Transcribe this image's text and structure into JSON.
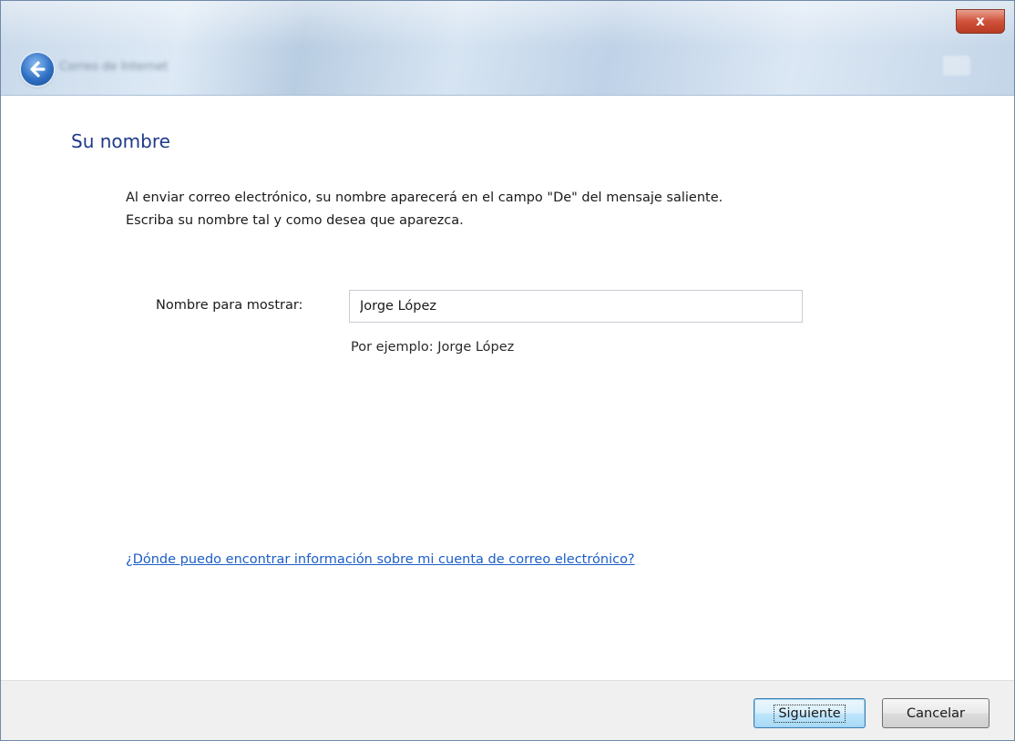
{
  "window": {
    "title": "Correo de Internet",
    "close_label": "x"
  },
  "page": {
    "heading": "Su nombre",
    "description_line1": "Al enviar correo electrónico, su nombre aparecerá en el campo \"De\" del mensaje saliente.",
    "description_line2": "Escriba su nombre tal y como desea que aparezca.",
    "display_name_label": "Nombre para mostrar:",
    "display_name_value": "Jorge López",
    "example_text": "Por ejemplo: Jorge López",
    "help_link": "¿Dónde puedo encontrar información sobre mi cuenta de correo electrónico?"
  },
  "footer": {
    "next_label": "Siguiente",
    "cancel_label": "Cancelar"
  },
  "icons": {
    "back": "back-arrow-icon",
    "close": "close-icon"
  },
  "colors": {
    "heading": "#1e3a8a",
    "link": "#1c5ec7",
    "close_button": "#d0523a"
  }
}
